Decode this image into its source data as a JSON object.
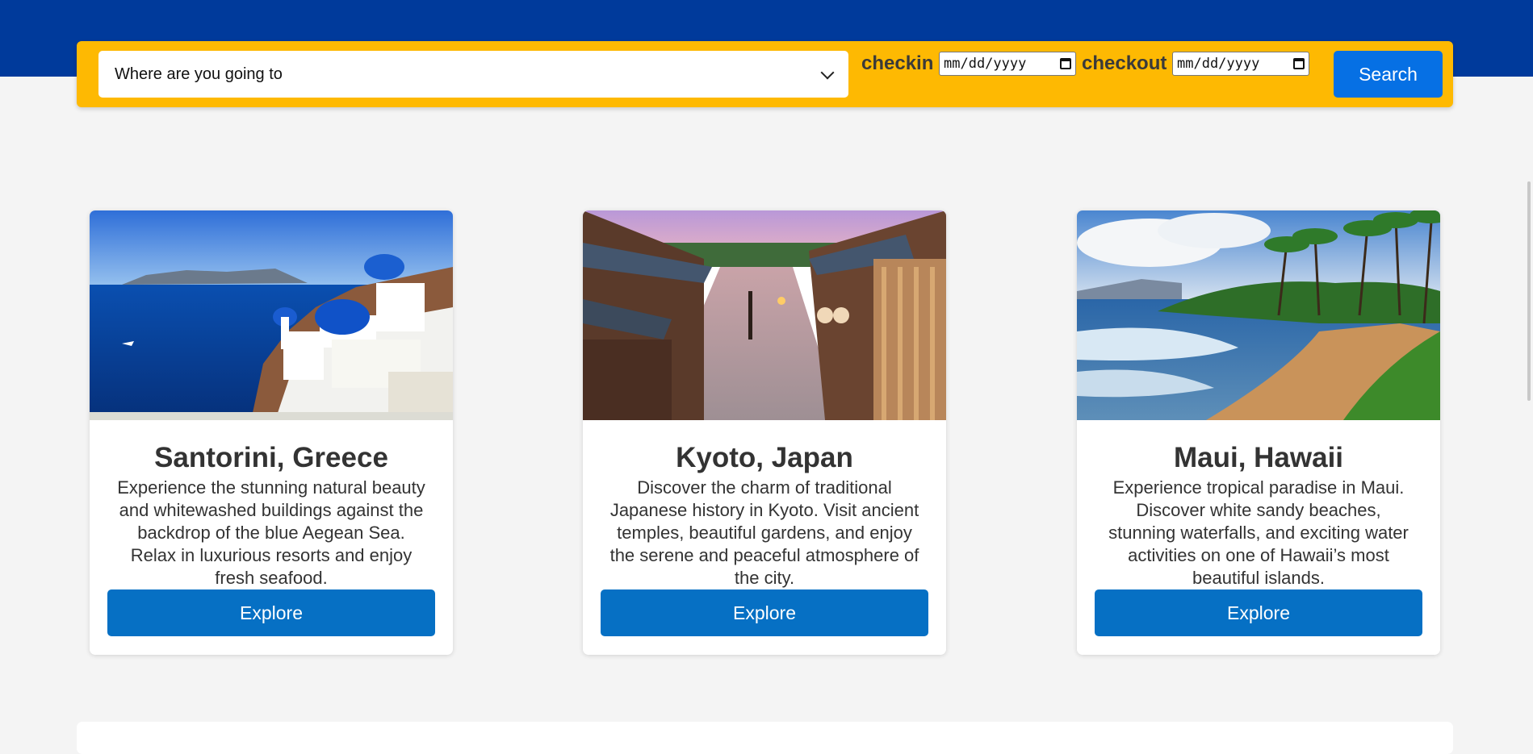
{
  "search": {
    "destination_placeholder": "Where are you going to",
    "checkin_label": "checkin",
    "checkin_value": "mm/dd/yyyy",
    "checkout_label": "checkout",
    "checkout_value": "mm/dd/yyyy",
    "search_label": "Search"
  },
  "cards": [
    {
      "title": "Santorini, Greece",
      "description": "Experience the stunning natural beauty and whitewashed buildings against the backdrop of the blue Aegean Sea. Relax in luxurious resorts and enjoy fresh seafood.",
      "button": "Explore"
    },
    {
      "title": "Kyoto, Japan",
      "description": "Discover the charm of traditional Japanese history in Kyoto. Visit ancient temples, beautiful gardens, and enjoy the serene and peaceful atmosphere of the city.",
      "button": "Explore"
    },
    {
      "title": "Maui, Hawaii",
      "description": "Experience tropical paradise in Maui. Discover white sandy beaches, stunning waterfalls, and exciting water activities on one of Hawaii’s most beautiful islands.",
      "button": "Explore"
    }
  ],
  "colors": {
    "header_band": "#003a9b",
    "search_bar": "#feb902",
    "search_button": "#0670e4",
    "explore_button": "#0670c4"
  }
}
